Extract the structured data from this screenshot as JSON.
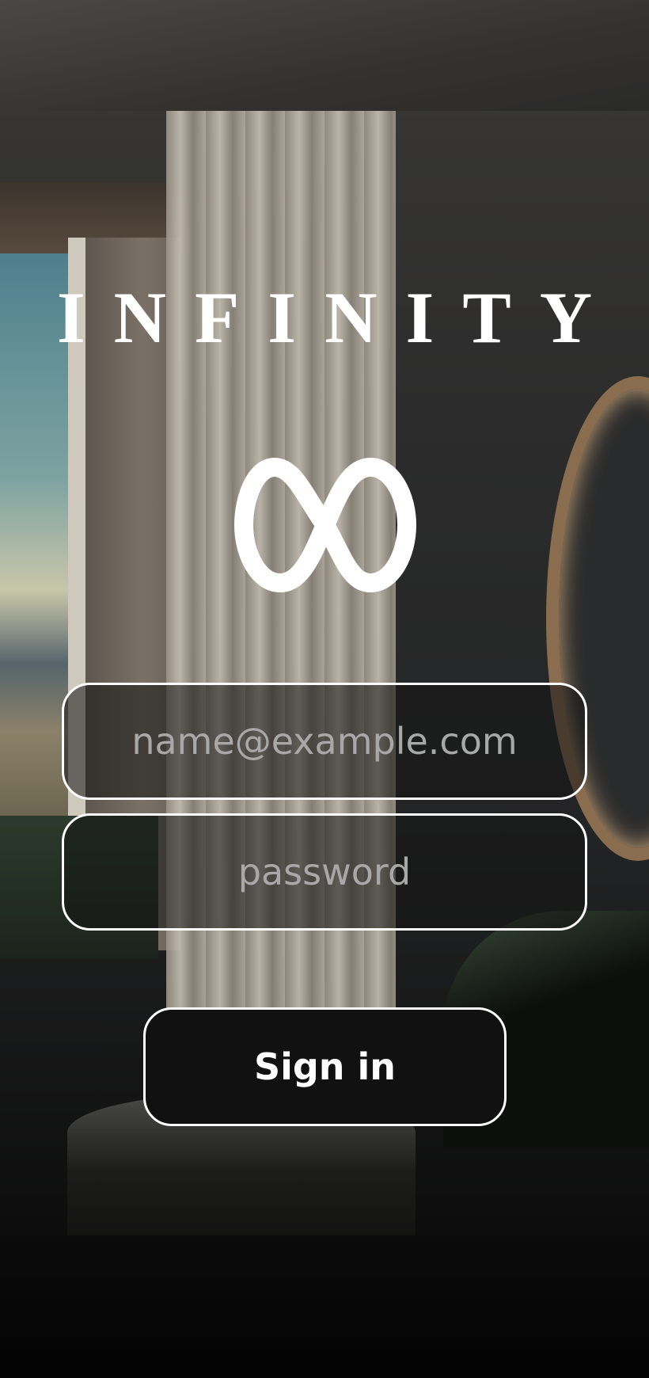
{
  "brand": {
    "title": "INFINITY",
    "logo_icon": "infinity-icon"
  },
  "form": {
    "email_placeholder": "name@example.com",
    "email_value": "",
    "password_placeholder": "password",
    "password_value": "",
    "signin_label": "Sign in"
  }
}
